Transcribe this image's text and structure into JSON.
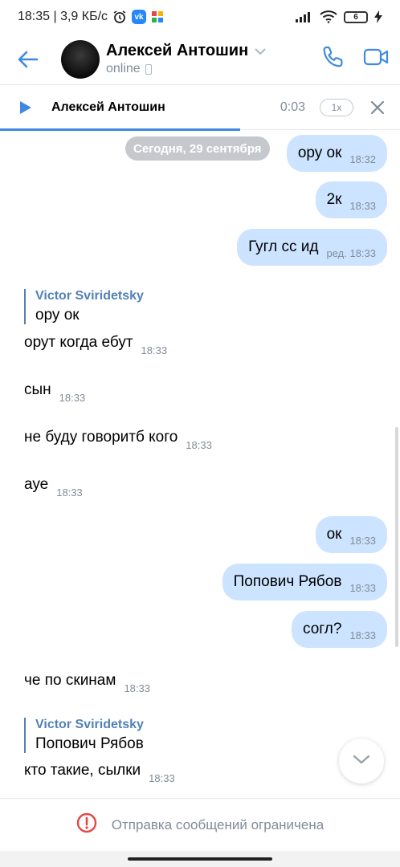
{
  "status_bar": {
    "time_and_speed": "18:35 | 3,9 КБ/с",
    "battery": "6"
  },
  "header": {
    "peer_name": "Алексей Антошин",
    "peer_status": "online"
  },
  "player": {
    "track_title": "Алексей Антошин",
    "elapsed": "0:03",
    "speed": "1x",
    "progress": 0.6
  },
  "chat": {
    "date_separator": "Сегодня, 29 сентября",
    "messages": [
      {
        "dir": "out",
        "text": "ору ок",
        "time": "18:32"
      },
      {
        "dir": "out",
        "text": "2к",
        "time": "18:33"
      },
      {
        "dir": "out",
        "text": "Гугл сс ид",
        "time": "ред. 18:33"
      },
      {
        "dir": "in",
        "reply_author": "Victor Sviridetsky",
        "reply_text": "ору ок"
      },
      {
        "dir": "in",
        "text": "орут когда ебут",
        "time": "18:33"
      },
      {
        "dir": "in",
        "text": "сын",
        "time": "18:33"
      },
      {
        "dir": "in",
        "text": "не буду говоритб кого",
        "time": "18:33"
      },
      {
        "dir": "in",
        "text": "ауе",
        "time": "18:33"
      },
      {
        "dir": "out",
        "text": "ок",
        "time": "18:33"
      },
      {
        "dir": "out",
        "text": "Попович Рябов",
        "time": "18:33"
      },
      {
        "dir": "out",
        "text": "согл?",
        "time": "18:33"
      },
      {
        "dir": "in",
        "text": "че по скинам",
        "time": "18:33"
      },
      {
        "dir": "in",
        "reply_author": "Victor Sviridetsky",
        "reply_text": "Попович Рябов"
      },
      {
        "dir": "in",
        "text": "кто такие, сылки",
        "time": "18:33"
      }
    ]
  },
  "footer": {
    "restriction_text": "Отправка сообщений ограничена"
  },
  "colors": {
    "accent": "#3f8ae0",
    "outgoing_bubble": "#cce4ff",
    "reply_author": "#5181b8",
    "error_red": "#e64646",
    "secondary_text": "#818c99"
  },
  "icons": {
    "back": "back-arrow-icon",
    "call": "phone-icon",
    "video": "video-camera-icon",
    "play": "play-icon",
    "close": "close-icon",
    "scroll": "chevron-down-icon",
    "warning": "exclamation-circle-icon"
  }
}
